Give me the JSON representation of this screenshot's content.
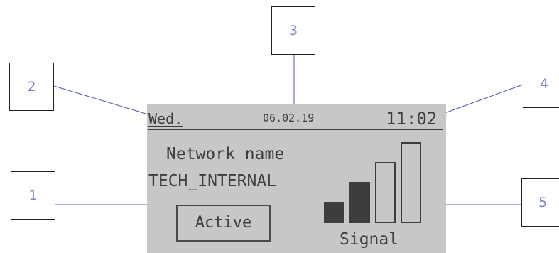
{
  "callouts": [
    {
      "id": "1",
      "label": "1"
    },
    {
      "id": "2",
      "label": "2"
    },
    {
      "id": "3",
      "label": "3"
    },
    {
      "id": "4",
      "label": "4"
    },
    {
      "id": "5",
      "label": "5"
    }
  ],
  "display": {
    "day": "Wed.",
    "date": "06.02.19",
    "time": "11:02",
    "network_label": "Network name",
    "network_name": "TECH_INTERNAL",
    "status": "Active",
    "signal_label": "Signal",
    "signal": {
      "total_bars": 4,
      "filled_bars": 2
    }
  },
  "colors": {
    "lcd_background": "#c7c7c7",
    "lcd_text": "#3d3d3d",
    "callout_number": "#7b86c8",
    "callout_line": "#4a57a8"
  }
}
